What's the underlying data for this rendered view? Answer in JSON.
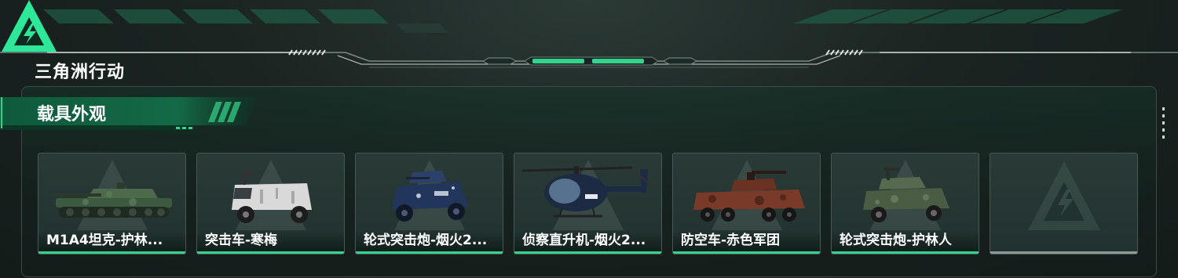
{
  "brand": {
    "logo_text": "三角洲行动",
    "accent": "#2ee89a"
  },
  "section": {
    "title": "载具外观"
  },
  "cards": [
    {
      "name": "M1A4坦克-护林...",
      "vehicle": "tank-icon",
      "color": "#3b5a40"
    },
    {
      "name": "突击车-寒梅",
      "vehicle": "armored-truck-icon",
      "color": "#d9d9d9"
    },
    {
      "name": "轮式突击炮-烟火2...",
      "vehicle": "armored-car-icon",
      "color": "#22355a"
    },
    {
      "name": "侦察直升机-烟火2...",
      "vehicle": "helicopter-icon",
      "color": "#1d2a44"
    },
    {
      "name": "防空车-赤色军团",
      "vehicle": "apc-icon",
      "color": "#7a3a2a"
    },
    {
      "name": "轮式突击炮-护林人",
      "vehicle": "armored-car-icon",
      "color": "#4a5c44"
    },
    {
      "name": "",
      "vehicle": "empty-slot",
      "color": "#8f9a97"
    }
  ]
}
